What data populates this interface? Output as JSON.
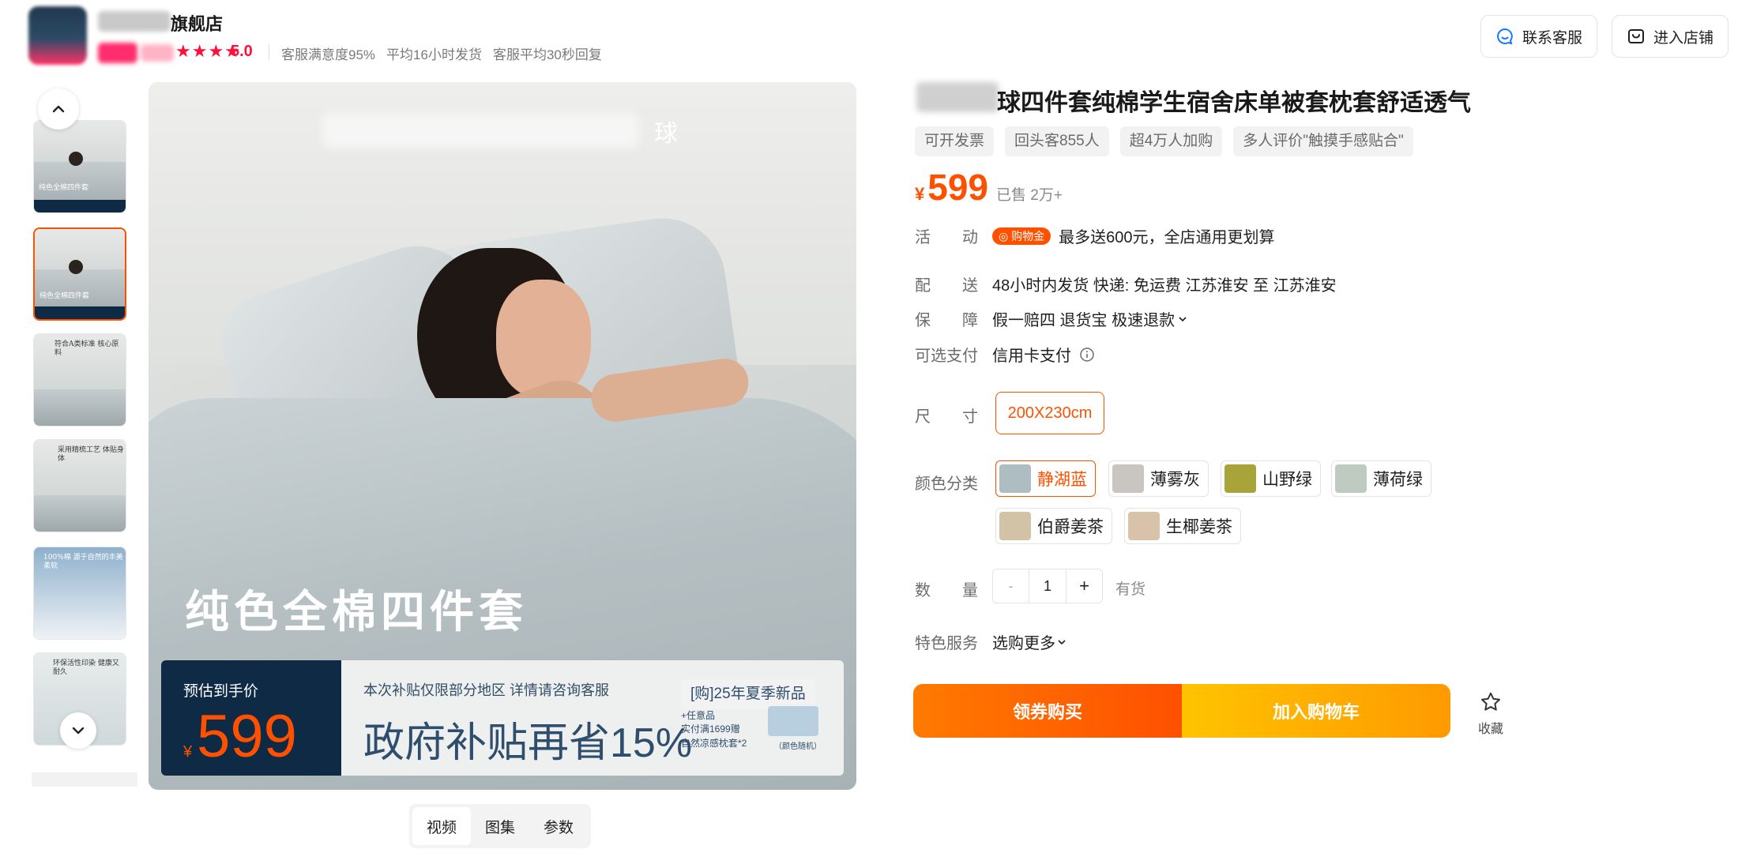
{
  "header": {
    "shop_name": "旗舰店",
    "rating": "5.0",
    "metrics": [
      "客服满意度95%",
      "平均16小时发货",
      "客服平均30秒回复"
    ],
    "btn_service": "联系客服",
    "btn_store": "进入店铺"
  },
  "gallery": {
    "brand_text": "球",
    "caption": "纯色全棉四件套",
    "promo": {
      "est_label": "预估到手价",
      "currency": "¥",
      "price": "599",
      "line1": "本次补贴仅限部分地区 详情请咨询客服",
      "headline": "政府补贴再省15%",
      "tag": "[购]25年夏季新品",
      "small_lines": [
        "+任意品",
        "实付满1699赠",
        "自然凉感枕套*2"
      ],
      "note": "（颜色随机）"
    },
    "thumbs": [
      {
        "text": "纯色全棉四件套"
      },
      {
        "text": "纯色全棉四件套"
      },
      {
        "text": "符合A类标准 核心原料"
      },
      {
        "text": "采用精梳工艺 体贴身体"
      },
      {
        "text": "100%棉 源于自然的丰美柔软"
      },
      {
        "text": "环保活性印染 健康又耐久"
      }
    ],
    "tabs": [
      "视频",
      "图集",
      "参数"
    ]
  },
  "product": {
    "title": "球四件套纯棉学生宿舍床单被套枕套舒适透气",
    "tags": [
      "可开发票",
      "回头客855人",
      "超4万人加购",
      "多人评价\"触摸手感贴合\""
    ],
    "currency": "¥",
    "price": "599",
    "sold": "已售 2万+",
    "activity_label": "活　　动",
    "activity_badge": "购物金",
    "activity_text": "最多送600元，全店通用更划算",
    "shipping_label": "配　　送",
    "shipping_text": "48小时内发货  快递: 免运费  江苏淮安  至  江苏淮安",
    "guarantee_label": "保　　障",
    "guarantee_text": "假一赔四 退货宝 极速退款",
    "payment_label": "可选支付",
    "payment_text": "信用卡支付",
    "size_label": "尺　　寸",
    "size_value": "200X230cm",
    "color_label": "颜色分类",
    "colors": [
      {
        "name": "静湖蓝",
        "swatch": "#aebdc2"
      },
      {
        "name": "薄雾灰",
        "swatch": "#c9c6c2"
      },
      {
        "name": "山野绿",
        "swatch": "#a9a43a"
      },
      {
        "name": "薄荷绿",
        "swatch": "#bfcbc0"
      },
      {
        "name": "伯爵姜茶",
        "swatch": "#d2c3a6"
      },
      {
        "name": "生椰姜茶",
        "swatch": "#d8c2aa"
      }
    ],
    "qty_label": "数　　量",
    "qty_minus": "-",
    "qty_value": "1",
    "qty_plus": "+",
    "stock": "有货",
    "service_label": "特色服务",
    "service_text": "选购更多",
    "btn_buy": "领券购买",
    "btn_cart": "加入购物车",
    "fav_label": "收藏"
  },
  "colors": {
    "accent": "#ff5000",
    "rating_red": "#ff0f3c",
    "promo_navy": "#0e2a45"
  }
}
